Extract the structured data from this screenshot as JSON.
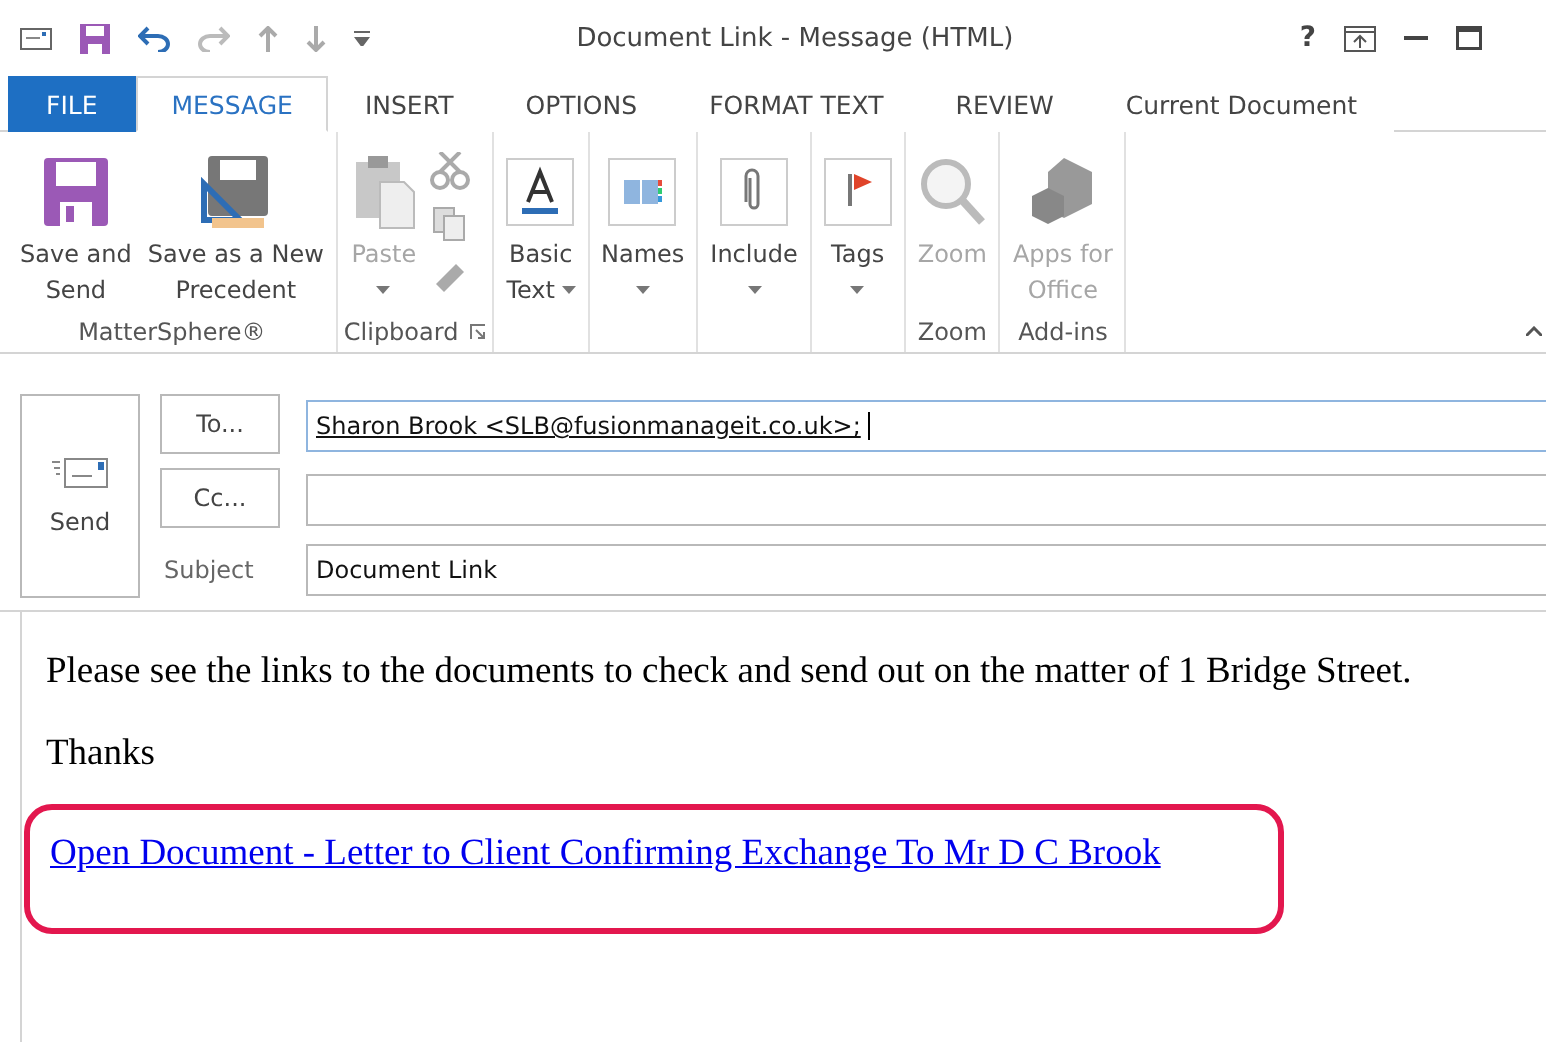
{
  "window": {
    "title": "Document Link - Message (HTML)",
    "help": "?"
  },
  "tabs": [
    {
      "label": "FILE",
      "kind": "file",
      "selected": false
    },
    {
      "label": "MESSAGE",
      "kind": "tab",
      "selected": true
    },
    {
      "label": "INSERT",
      "kind": "tab",
      "selected": false
    },
    {
      "label": "OPTIONS",
      "kind": "tab",
      "selected": false
    },
    {
      "label": "FORMAT TEXT",
      "kind": "tab",
      "selected": false
    },
    {
      "label": "REVIEW",
      "kind": "tab",
      "selected": false
    },
    {
      "label": "Current Document",
      "kind": "tab",
      "selected": false
    }
  ],
  "ribbon_groups": [
    {
      "label": "MatterSphere®",
      "buttons": [
        {
          "lines": [
            "Save and",
            "Send"
          ],
          "disabled": false
        },
        {
          "lines": [
            "Save as a New",
            "Precedent"
          ],
          "disabled": false
        }
      ]
    },
    {
      "label": "Clipboard",
      "launcher": true,
      "buttons": [
        {
          "lines": [
            "Paste"
          ],
          "disabled": true,
          "dropdown": true
        },
        {
          "kind": "tools",
          "disabled": true
        }
      ]
    },
    {
      "buttons": [
        {
          "lines": [
            "Basic",
            "Text"
          ],
          "disabled": false,
          "dropdown": true
        }
      ]
    },
    {
      "buttons": [
        {
          "lines": [
            "Names"
          ],
          "disabled": false,
          "dropdown": true
        }
      ]
    },
    {
      "buttons": [
        {
          "lines": [
            "Include"
          ],
          "disabled": false,
          "dropdown": true
        }
      ]
    },
    {
      "buttons": [
        {
          "lines": [
            "Tags"
          ],
          "disabled": false,
          "dropdown": true
        }
      ]
    },
    {
      "label": "Zoom",
      "buttons": [
        {
          "lines": [
            "Zoom"
          ],
          "disabled": true
        }
      ]
    },
    {
      "label": "Add-ins",
      "buttons": [
        {
          "lines": [
            "Apps for",
            "Office"
          ],
          "disabled": true
        }
      ]
    }
  ],
  "send_button": "Send",
  "to": {
    "button": "To...",
    "value": "Sharon Brook <SLB@fusionmanageit.co.uk>;"
  },
  "cc": {
    "button": "Cc..."
  },
  "subject": {
    "label": "Subject",
    "value": "Document Link"
  },
  "body": {
    "paragraphs": [
      "Please see the links to the documents to check and send out on the matter of 1 Bridge Street.",
      "Thanks"
    ],
    "link": "Open Document - Letter to Client Confirming Exchange To Mr D C Brook",
    "link_highlighted": true
  }
}
